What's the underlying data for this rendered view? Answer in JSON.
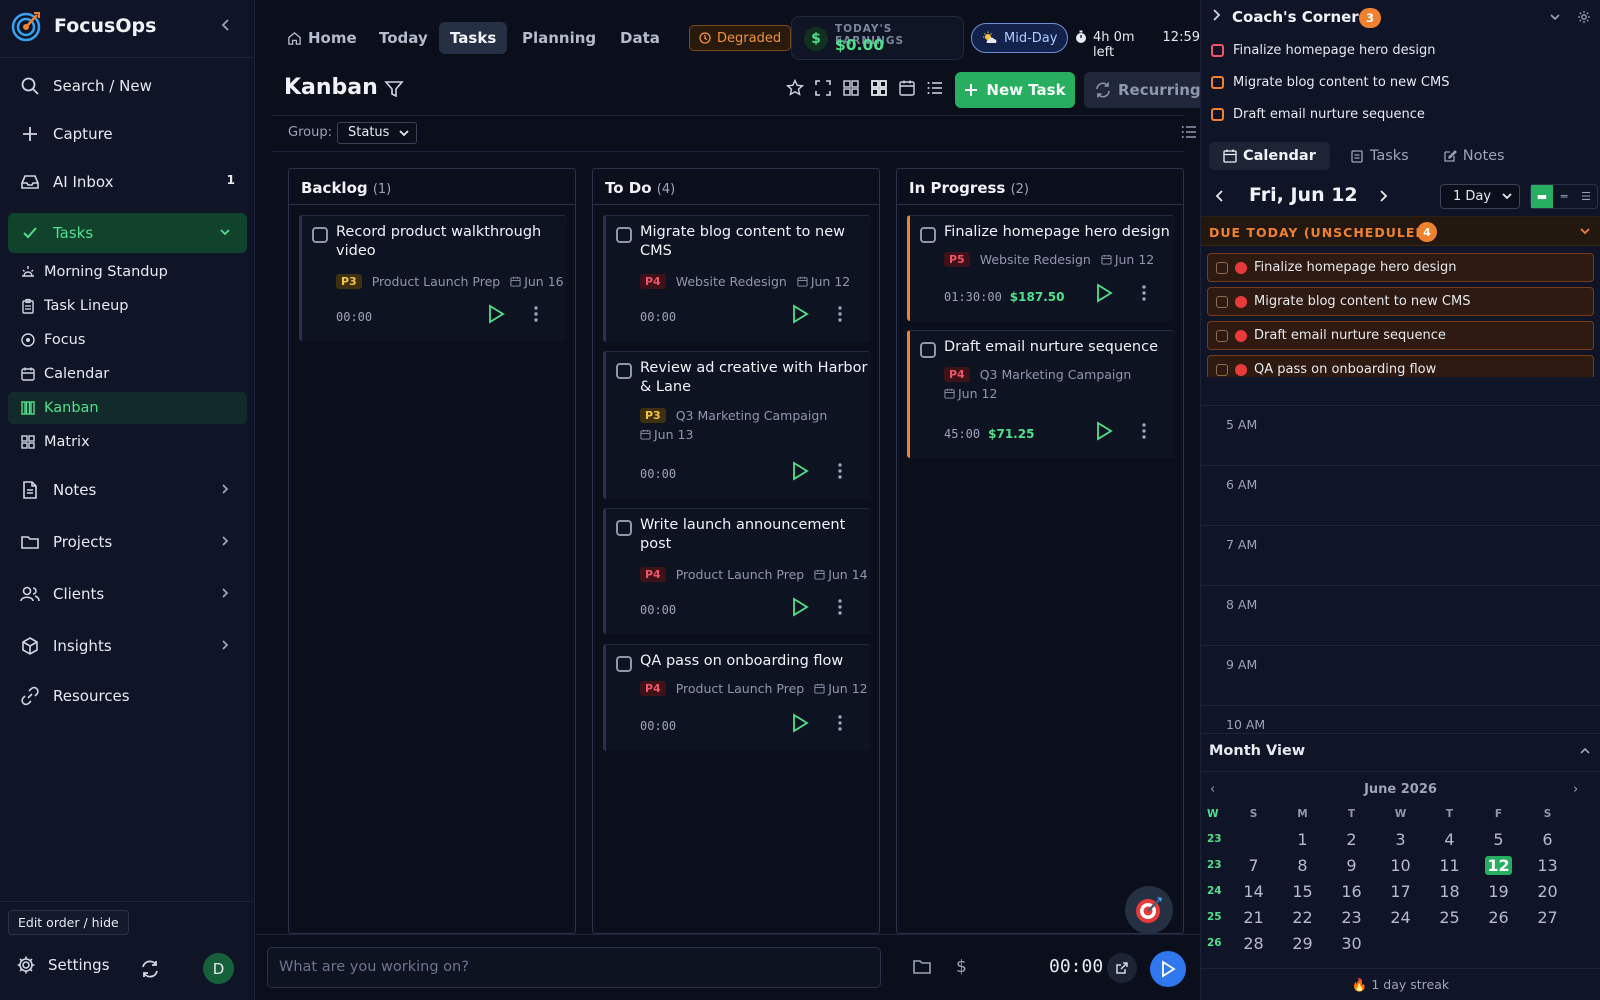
{
  "brand": {
    "name": "FocusOps"
  },
  "sidebar": {
    "nav": [
      {
        "label": "Search / New",
        "icon": "search-icon"
      },
      {
        "label": "Capture",
        "icon": "plus-icon"
      },
      {
        "label": "AI Inbox",
        "icon": "inbox-icon",
        "badge": "1"
      },
      {
        "label": "Tasks",
        "icon": "check-icon"
      }
    ],
    "tasks_sub": [
      "Morning Standup",
      "Task Lineup",
      "Focus",
      "Calendar",
      "Kanban",
      "Matrix"
    ],
    "groups": [
      "Notes",
      "Projects",
      "Clients",
      "Insights",
      "Resources"
    ],
    "edit_order": "Edit order / hide",
    "settings": "Settings",
    "avatar": "D"
  },
  "topbar": {
    "tabs": [
      "Home",
      "Today",
      "Tasks",
      "Planning",
      "Data"
    ],
    "active_tab": "Tasks",
    "status": "Degraded",
    "earnings_label": "TODAY'S EARNINGS",
    "earnings_value": "$0.00",
    "midday": "Mid-Day",
    "time_left": "4h 0m left",
    "clock": "12:59"
  },
  "kanban": {
    "title": "Kanban",
    "new_task": "New Task",
    "recurring": "Recurring",
    "group_label": "Group:",
    "group_value": "Status",
    "columns": [
      {
        "name": "Backlog",
        "count": "(1)",
        "cards": [
          {
            "title": "Record product walkthrough video",
            "priority": "P3",
            "project": "Product Launch Prep",
            "date": "Jun 16",
            "time": "00:00",
            "amount": ""
          }
        ]
      },
      {
        "name": "To Do",
        "count": "(4)",
        "cards": [
          {
            "title": "Migrate blog content to new CMS",
            "priority": "P4",
            "project": "Website Redesign",
            "date": "Jun 12",
            "time": "00:00",
            "amount": ""
          },
          {
            "title": "Review ad creative with Harbor & Lane",
            "priority": "P3",
            "project": "Q3 Marketing Campaign",
            "date": "Jun 13",
            "time": "00:00",
            "amount": ""
          },
          {
            "title": "Write launch announcement post",
            "priority": "P4",
            "project": "Product Launch Prep",
            "date": "Jun 14",
            "time": "00:00",
            "amount": ""
          },
          {
            "title": "QA pass on onboarding flow",
            "priority": "P4",
            "project": "Product Launch Prep",
            "date": "Jun 12",
            "time": "00:00",
            "amount": ""
          }
        ]
      },
      {
        "name": "In Progress",
        "count": "(2)",
        "cards": [
          {
            "title": "Finalize homepage hero design",
            "priority": "P5",
            "project": "Website Redesign",
            "date": "Jun 12",
            "time": "01:30:00",
            "amount": "$187.50"
          },
          {
            "title": "Draft email nurture sequence",
            "priority": "P4",
            "project": "Q3 Marketing Campaign",
            "date": "Jun 12",
            "time": "45:00",
            "amount": "$71.25"
          }
        ]
      }
    ]
  },
  "bottombar": {
    "placeholder": "What are you working on?",
    "timer": "00:00"
  },
  "coach": {
    "title": "Coach's Corner",
    "badge": "3",
    "items": [
      "Finalize homepage hero design",
      "Migrate blog content to new CMS",
      "Draft email nurture sequence"
    ]
  },
  "rightpanel": {
    "tabs": [
      "Calendar",
      "Tasks",
      "Notes"
    ],
    "day_title": "Fri, Jun 12",
    "range": "1 Day",
    "due_title": "DUE TODAY (UNSCHEDULED)",
    "due_count": "4",
    "due_items": [
      "Finalize homepage hero design",
      "Migrate blog content to new CMS",
      "Draft email nurture sequence",
      "QA pass on onboarding flow"
    ],
    "hours": [
      "5 AM",
      "6 AM",
      "7 AM",
      "8 AM",
      "9 AM",
      "10 AM"
    ],
    "month_view": "Month View",
    "month_title": "June 2026",
    "weekday_head": [
      "W",
      "S",
      "M",
      "T",
      "W",
      "T",
      "F",
      "S"
    ],
    "weeks": [
      {
        "wk": "23",
        "days": [
          "",
          "1",
          "2",
          "3",
          "4",
          "5",
          "6"
        ]
      },
      {
        "wk": "23",
        "days": [
          "7",
          "8",
          "9",
          "10",
          "11",
          "12",
          "13"
        ]
      },
      {
        "wk": "24",
        "days": [
          "14",
          "15",
          "16",
          "17",
          "18",
          "19",
          "20"
        ]
      },
      {
        "wk": "25",
        "days": [
          "21",
          "22",
          "23",
          "24",
          "25",
          "26",
          "27"
        ]
      },
      {
        "wk": "26",
        "days": [
          "28",
          "29",
          "30",
          "",
          "",
          "",
          ""
        ]
      }
    ],
    "today": "12",
    "streak": "🔥 1 day streak"
  },
  "colors": {
    "accent": "#27ae60",
    "in_progress": "#f0822f",
    "danger": "#e83a3a",
    "play_blue": "#2f78ef"
  }
}
